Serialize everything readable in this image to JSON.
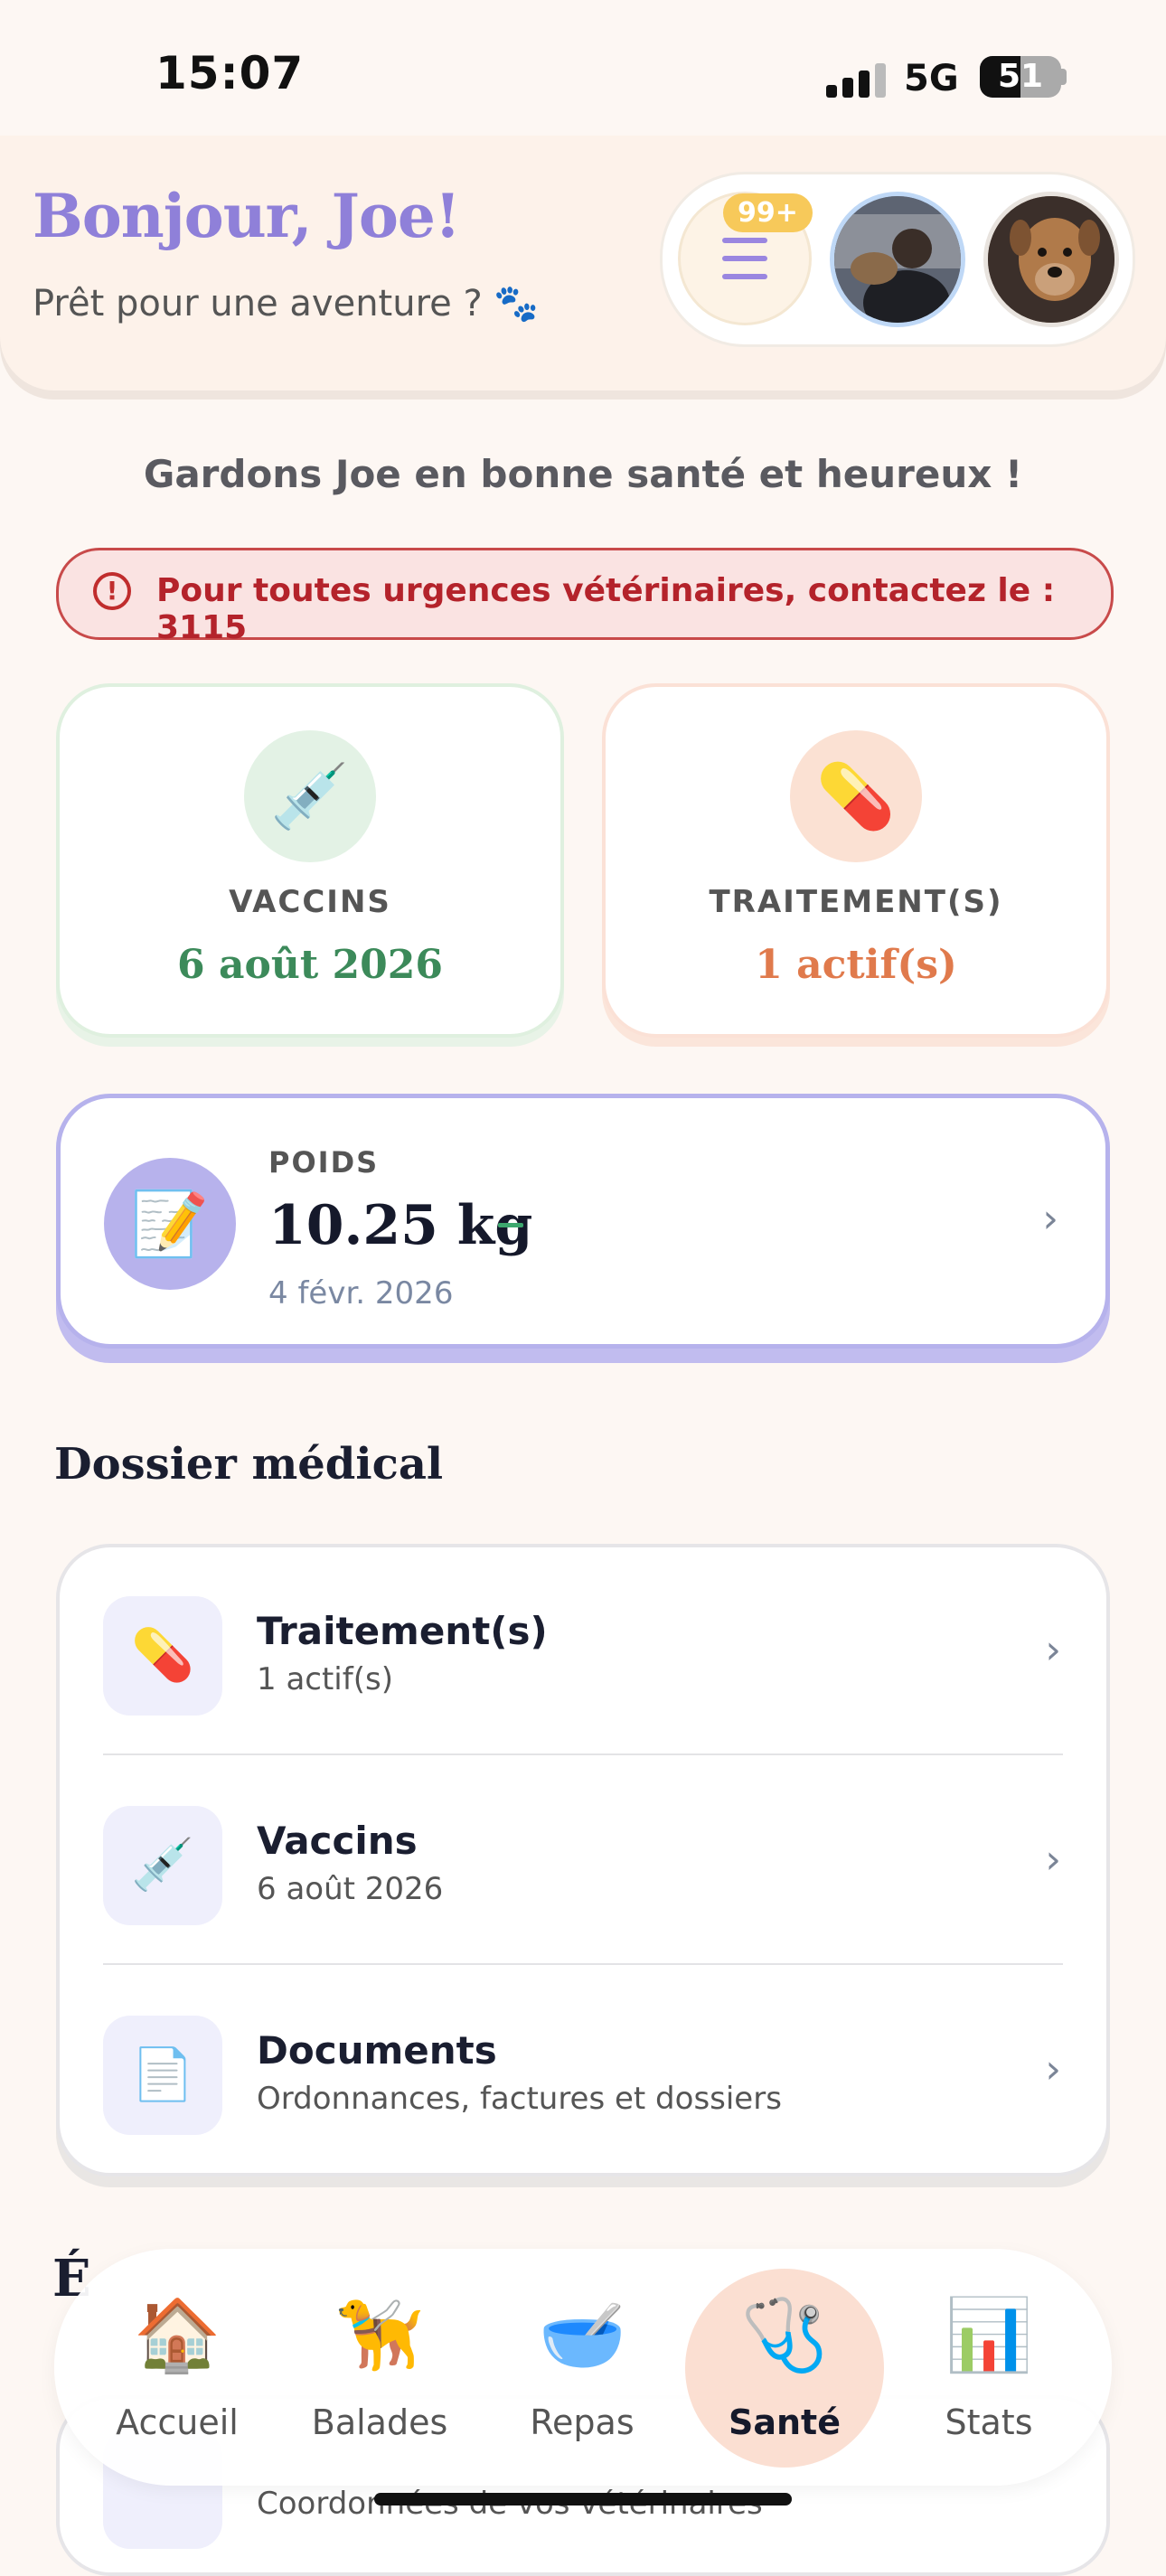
{
  "status_bar": {
    "time": "15:07",
    "network": "5G",
    "battery": "51"
  },
  "header": {
    "greeting": "Bonjour, Joe!",
    "subtitle": "Prêt pour une aventure ? 🐾",
    "notification_badge": "99+"
  },
  "motto": "Gardons Joe en bonne santé et heureux !",
  "alert": {
    "text": "Pour toutes urgences vétérinaires, contactez le : 3115",
    "color": "#b4232b"
  },
  "summary": {
    "vaccins": {
      "label": "VACCINS",
      "value": "6 août 2026",
      "icon": "syringe-icon",
      "color": "#3c8a5a"
    },
    "traitements": {
      "label": "TRAITEMENT(S)",
      "value": "1 actif(s)",
      "icon": "pill-icon",
      "color": "#e07a4c"
    }
  },
  "poids": {
    "label": "POIDS",
    "value": "10.25 kg",
    "date": "4 févr. 2026",
    "icon": "memo-icon"
  },
  "dossier": {
    "title": "Dossier médical",
    "rows": [
      {
        "title": "Traitement(s)",
        "subtitle": "1 actif(s)",
        "icon": "pill-icon"
      },
      {
        "title": "Vaccins",
        "subtitle": "6 août 2026",
        "icon": "syringe-icon"
      },
      {
        "title": "Documents",
        "subtitle": "Ordonnances, factures et dossiers",
        "icon": "document-icon"
      }
    ]
  },
  "partial_section": {
    "title_letter": "É",
    "peek_subtitle": "Coordonnées de vos vétérinaires"
  },
  "tabs": [
    {
      "label": "Accueil",
      "icon": "house-icon",
      "glyph": "🏠",
      "active": false
    },
    {
      "label": "Balades",
      "icon": "leash-icon",
      "glyph": "🦮",
      "active": false
    },
    {
      "label": "Repas",
      "icon": "food-bowl-icon",
      "glyph": "🥣",
      "active": false
    },
    {
      "label": "Santé",
      "icon": "vet-clipboard-icon",
      "glyph": "🩺",
      "active": true
    },
    {
      "label": "Stats",
      "icon": "chart-icon",
      "glyph": "📊",
      "active": false
    }
  ]
}
